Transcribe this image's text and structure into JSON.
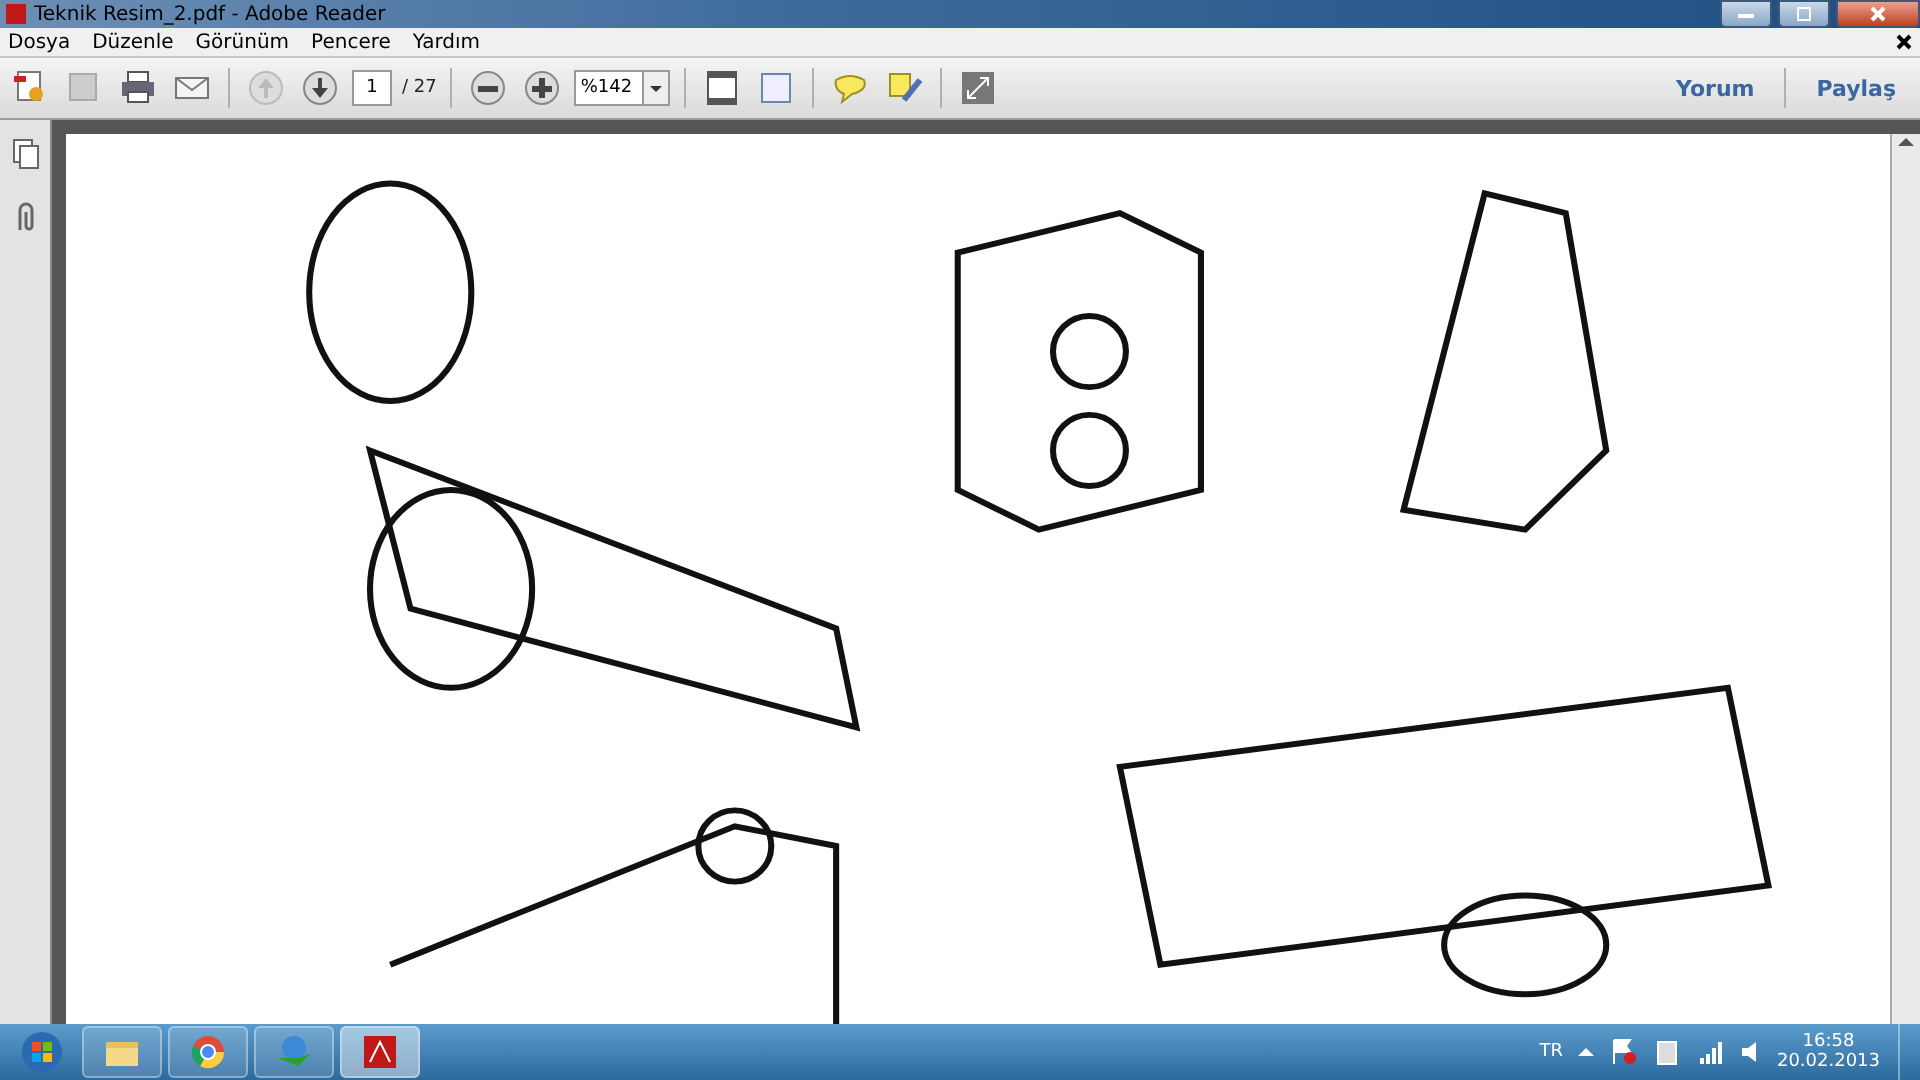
{
  "window": {
    "title": "Teknik Resim_2.pdf - Adobe Reader"
  },
  "menu": [
    "Dosya",
    "Düzenle",
    "Görünüm",
    "Pencere",
    "Yardım"
  ],
  "toolbar": {
    "page": "1",
    "page_total": "/ 27",
    "zoom": "%142",
    "actions": [
      "Yorum",
      "Paylaş"
    ]
  },
  "taskbar": {
    "apps": [
      {
        "kind": "folder",
        "selected": false
      },
      {
        "kind": "browser",
        "selected": false
      },
      {
        "kind": "download",
        "selected": false
      },
      {
        "kind": "pdf",
        "selected": true
      }
    ],
    "language": "TR",
    "time": "16:58",
    "date": "20.02.2013"
  }
}
